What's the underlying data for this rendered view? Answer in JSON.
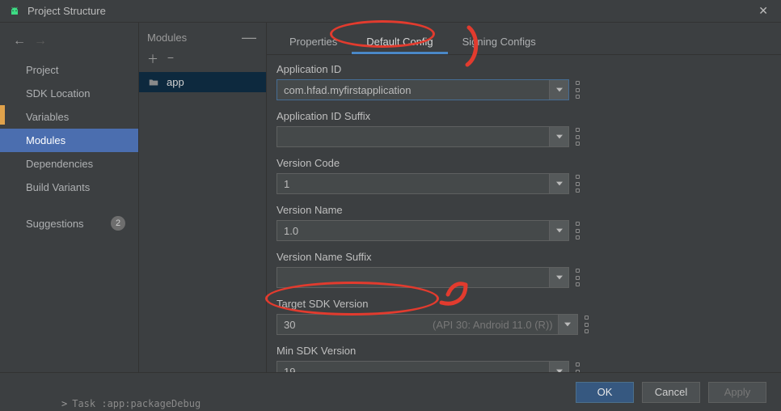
{
  "window": {
    "title": "Project Structure"
  },
  "sidebar": {
    "items": [
      "Project",
      "SDK Location",
      "Variables",
      "Modules",
      "Dependencies",
      "Build Variants"
    ],
    "selected_index": 3,
    "suggestions_label": "Suggestions",
    "suggestions_count": "2"
  },
  "modules_panel": {
    "header": "Modules",
    "module_name": "app"
  },
  "tabs": {
    "items": [
      "Properties",
      "Default Config",
      "Signing Configs"
    ],
    "active_index": 1
  },
  "form": {
    "app_id": {
      "label": "Application ID",
      "value": "com.hfad.myfirstapplication"
    },
    "app_id_suffix": {
      "label": "Application ID Suffix",
      "value": ""
    },
    "version_code": {
      "label": "Version Code",
      "value": "1"
    },
    "version_name": {
      "label": "Version Name",
      "value": "1.0"
    },
    "version_name_suffix": {
      "label": "Version Name Suffix",
      "value": ""
    },
    "target_sdk": {
      "label": "Target SDK Version",
      "value": "30",
      "hint": "(API 30: Android 11.0 (R))"
    },
    "min_sdk": {
      "label": "Min SDK Version",
      "value": "19"
    }
  },
  "footer": {
    "ok": "OK",
    "cancel": "Cancel",
    "apply": "Apply"
  },
  "task_line": "Task :app:packageDebug"
}
